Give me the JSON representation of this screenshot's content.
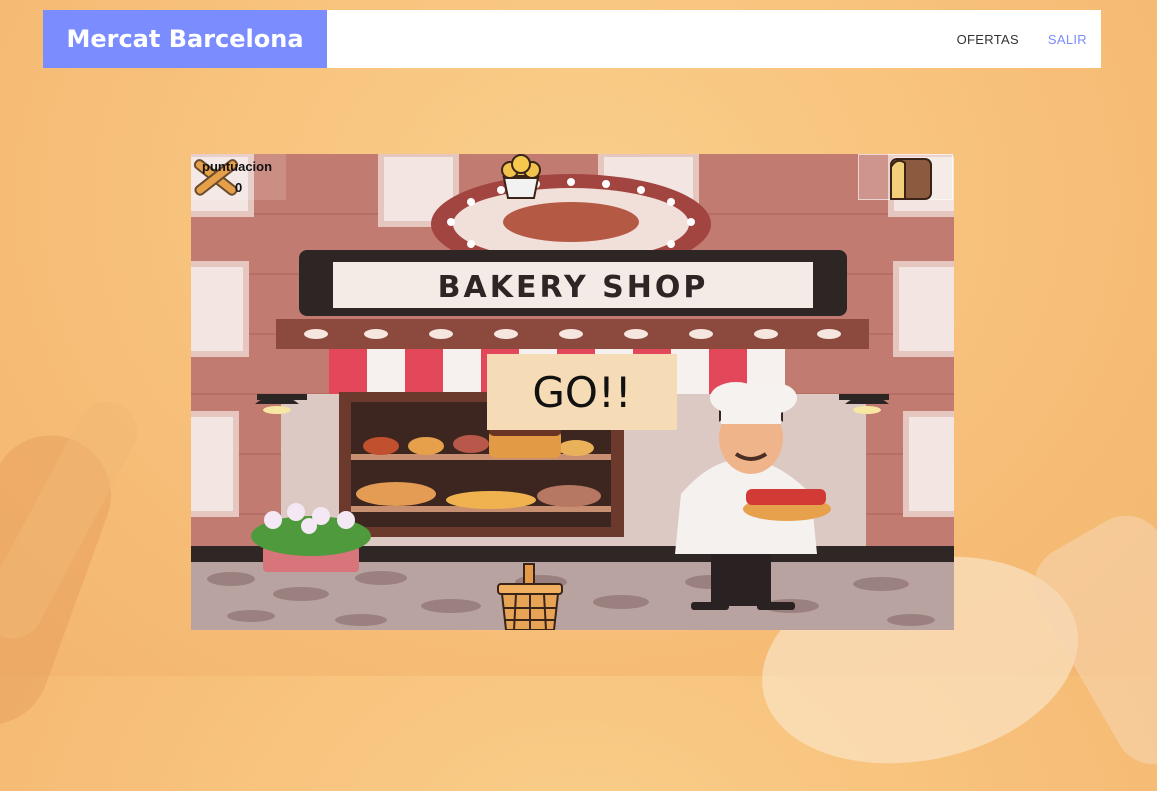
{
  "navbar": {
    "brand": "Mercat Barcelona",
    "links": [
      {
        "label": "OFERTAS",
        "color": "#333333"
      },
      {
        "label": "SALIR",
        "color": "#7b8cff"
      }
    ],
    "brand_color": "#7b8cff"
  },
  "game": {
    "score_label": "puntuacion",
    "score_value": "0",
    "shop_sign": "BAKERY SHOP",
    "go_text": "GO!!",
    "next_item_icon": "bread-slice-icon",
    "falling_item_icon": "muffin-icon",
    "player_icon": "basket-icon",
    "lives_icon": "crossed-rolling-pins-icon"
  }
}
